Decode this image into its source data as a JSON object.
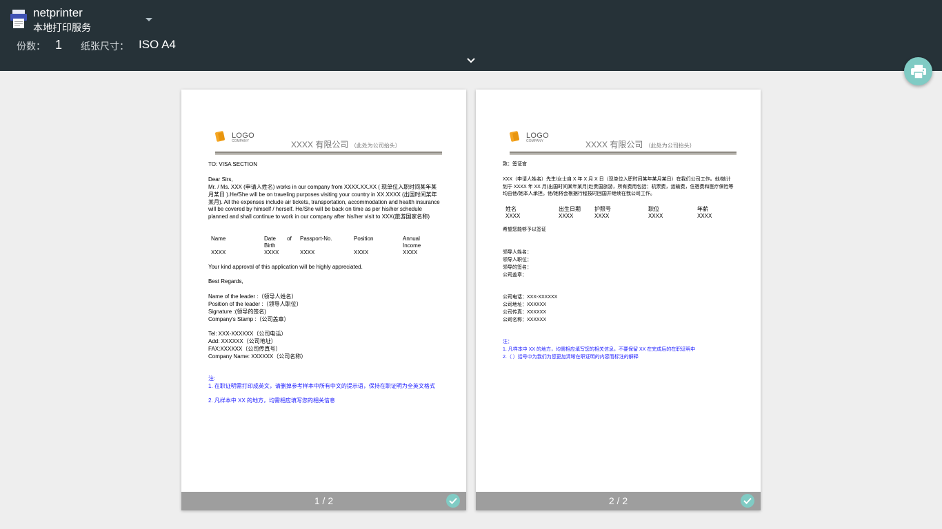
{
  "printer": {
    "name": "netprinter",
    "service": "本地打印服务",
    "icon": "printer-icon",
    "dropdown_icon": "chevron-down-icon"
  },
  "options": {
    "copies_label": "份数：",
    "copies_value": "1",
    "paper_label": "纸张尺寸：",
    "paper_value": "ISO A4",
    "expand_icon": "chevron-down-icon"
  },
  "print_button": {
    "icon": "print-icon",
    "color": "#80cbc4"
  },
  "colors": {
    "topbar": "#263238",
    "background": "#eeeeee",
    "accent": "#80cbc4",
    "footer": "#9e9e9e",
    "note_blue": "#1a1aff"
  },
  "pages": [
    {
      "footer": "1 / 2",
      "selected": true,
      "logo": "LOGO",
      "logo_sub": "COMPANY",
      "company_title": "XXXX 有限公司",
      "company_note": "（此处为公司抬头）",
      "to": "TO: VISA SECTION",
      "salutation": "Dear Sirs,",
      "paragraph": "Mr. / Ms. XXX (申请人姓名) works in our company from XXXX.XX.XX ( 现单位入职时间某年某月某日 ).He/She will be on traveling purposes visiting your country in XX.XXXX (出国时间某年某月). All the expenses include air tickets, transportation, accommodation and health insurance will be covered by himself / herself. He/She will be back on time as per his/her schedule planned and shall continue to work in our company after his/her visit to XXX(旅游国家名称)",
      "table_headers": [
        "Name",
        "Date of Birth",
        "Passport-No.",
        "Position",
        "Annual Income"
      ],
      "table_row": [
        "XXXX",
        "XXXX",
        "XXXX",
        "XXXX",
        "XXXX"
      ],
      "approval": "Your kind approval of this application will be highly appreciated.",
      "regards": "Best Regards,",
      "leader_lines": [
        "Name of the leader :（领导人姓名）",
        "Position of the leader :（领导人职位）",
        "Signature :(领导的签名)",
        "Company's Stamp :（公司盖章）"
      ],
      "contact_lines": [
        "Tel: XXX-XXXXXX（公司电话）",
        "Add: XXXXXX（公司地址）",
        "FAX:XXXXXX（公司传真号）",
        "Company Name: XXXXXX（公司名称）"
      ],
      "notes": [
        "注:",
        "1. 在职证明需打印成英文，请删掉参考样本中所有中文的提示语，保持在职证明为全英文格式",
        "2. 凡样本中 XX 的地方，均需相应填写您的相关信息"
      ]
    },
    {
      "footer": "2 / 2",
      "selected": true,
      "logo": "LOGO",
      "logo_sub": "COMPANY",
      "company_title": "XXXX 有限公司",
      "company_note": "（此处为公司抬头）",
      "to": "致：签证官",
      "paragraph": "XXX（申请人姓名）先生/女士自 X 年 X 月 X 日（现单位入职时间某年某月某日）在我们公司工作。他/她计划于 XXXX 年 XX 月(出国时间某年某月)赴贵国旅游，所有费用包括：机票费，运输费，住宿费和医疗保险等均由他/她本人承担。他/她将会根据行程按时回国并继续在我公司工作。",
      "table_headers": [
        "姓名",
        "出生日期",
        "护照号",
        "职位",
        "年薪"
      ],
      "table_row": [
        "XXXX",
        "XXXX",
        "XXXX",
        "XXXX",
        "XXXX"
      ],
      "request": "希望您能够予以签证",
      "leader_lines": [
        "领导人姓名：",
        "领导人职位：",
        "领导的签名：",
        "公司盖章："
      ],
      "contact_lines": [
        "公司电话：XXX-XXXXXX",
        "公司地址：XXXXXX",
        "公司传真：XXXXXX",
        "公司名称：XXXXXX"
      ],
      "notes": [
        "注：",
        "1. 凡样本中 XX 的地方，均需相应填写您的相关信息，不要保留 XX 在完成后的在职证明中",
        "2.（ ）括号中为我们为您更加清晰在职证明的内容而标注的解释"
      ]
    }
  ]
}
